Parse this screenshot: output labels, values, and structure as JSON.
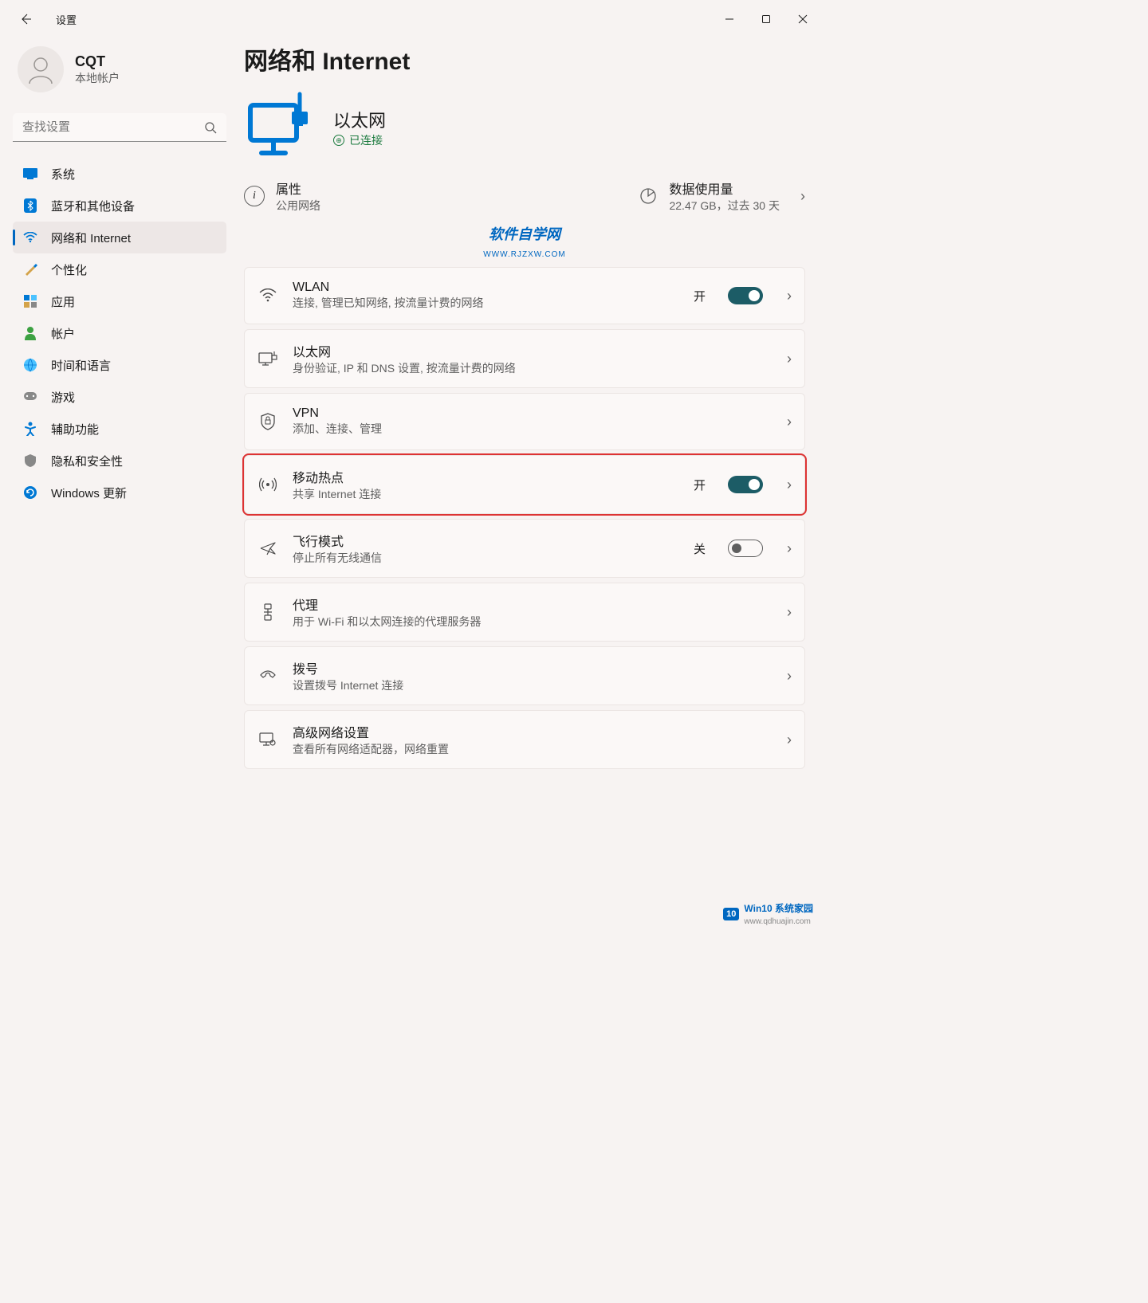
{
  "window": {
    "title": "设置"
  },
  "profile": {
    "name": "CQT",
    "sub": "本地帐户"
  },
  "search": {
    "placeholder": "查找设置"
  },
  "sidebar": {
    "items": [
      {
        "label": "系统"
      },
      {
        "label": "蓝牙和其他设备"
      },
      {
        "label": "网络和 Internet"
      },
      {
        "label": "个性化"
      },
      {
        "label": "应用"
      },
      {
        "label": "帐户"
      },
      {
        "label": "时间和语言"
      },
      {
        "label": "游戏"
      },
      {
        "label": "辅助功能"
      },
      {
        "label": "隐私和安全性"
      },
      {
        "label": "Windows 更新"
      }
    ]
  },
  "page": {
    "title": "网络和 Internet"
  },
  "hero": {
    "title": "以太网",
    "status": "已连接"
  },
  "info": {
    "props": {
      "title": "属性",
      "sub": "公用网络"
    },
    "usage": {
      "title": "数据使用量",
      "sub": "22.47 GB，过去 30 天"
    }
  },
  "watermark": {
    "title": "软件自学网",
    "sub": "WWW.RJZXW.COM"
  },
  "cards": {
    "wlan": {
      "title": "WLAN",
      "sub": "连接, 管理已知网络, 按流量计费的网络",
      "state": "开"
    },
    "ethernet": {
      "title": "以太网",
      "sub": "身份验证, IP 和 DNS 设置, 按流量计费的网络"
    },
    "vpn": {
      "title": "VPN",
      "sub": "添加、连接、管理"
    },
    "hotspot": {
      "title": "移动热点",
      "sub": "共享 Internet 连接",
      "state": "开"
    },
    "airplane": {
      "title": "飞行模式",
      "sub": "停止所有无线通信",
      "state": "关"
    },
    "proxy": {
      "title": "代理",
      "sub": "用于 Wi-Fi 和以太网连接的代理服务器"
    },
    "dialup": {
      "title": "拨号",
      "sub": "设置拨号 Internet 连接"
    },
    "advanced": {
      "title": "高级网络设置",
      "sub": "查看所有网络适配器，网络重置"
    }
  },
  "footer": {
    "badge": "10",
    "t1": "Win10 系统家园",
    "t2": "www.qdhuajin.com"
  }
}
